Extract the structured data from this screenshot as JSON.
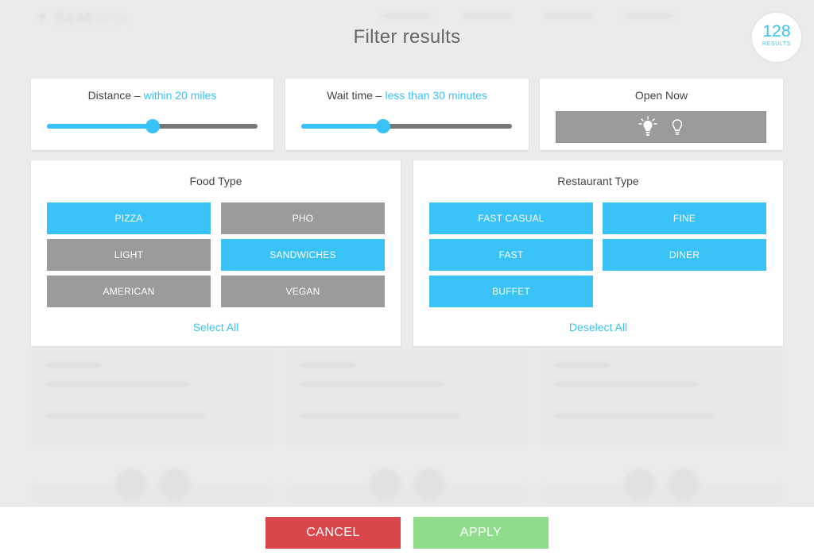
{
  "background": {
    "logo_bold": "Seat",
    "logo_thin": "ninja"
  },
  "header": {
    "title": "Filter results",
    "results_count": "128",
    "results_label": "RESULTS"
  },
  "distance": {
    "label": "Distance –",
    "value": "within 20 miles",
    "level": 0.5
  },
  "wait_time": {
    "label": "Wait time –",
    "value": "less than 30 minutes",
    "level": 0.39
  },
  "open_now": {
    "label": "Open Now",
    "icons": [
      "lit-bulb-icon",
      "unlit-bulb-icon"
    ]
  },
  "food_type": {
    "title": "Food Type",
    "options": [
      {
        "label": "PIZZA",
        "selected": true
      },
      {
        "label": "PHO",
        "selected": false
      },
      {
        "label": "LIGHT",
        "selected": false
      },
      {
        "label": "SANDWICHES",
        "selected": true
      },
      {
        "label": "AMERICAN",
        "selected": false
      },
      {
        "label": "VEGAN",
        "selected": false
      }
    ],
    "action": "Select All"
  },
  "restaurant_type": {
    "title": "Restaurant Type",
    "options": [
      {
        "label": "FAST CASUAL",
        "selected": true
      },
      {
        "label": "FINE",
        "selected": true
      },
      {
        "label": "FAST",
        "selected": true
      },
      {
        "label": "DINER",
        "selected": true
      },
      {
        "label": "BUFFET",
        "selected": true
      }
    ],
    "action": "Deselect All"
  },
  "footer": {
    "cancel_label": "CANCEL",
    "apply_label": "APPLY"
  },
  "colors": {
    "accent": "#38c2f5",
    "chip_off": "#9b9b9b",
    "cancel": "#d9474b",
    "apply": "#8fdd8a"
  }
}
